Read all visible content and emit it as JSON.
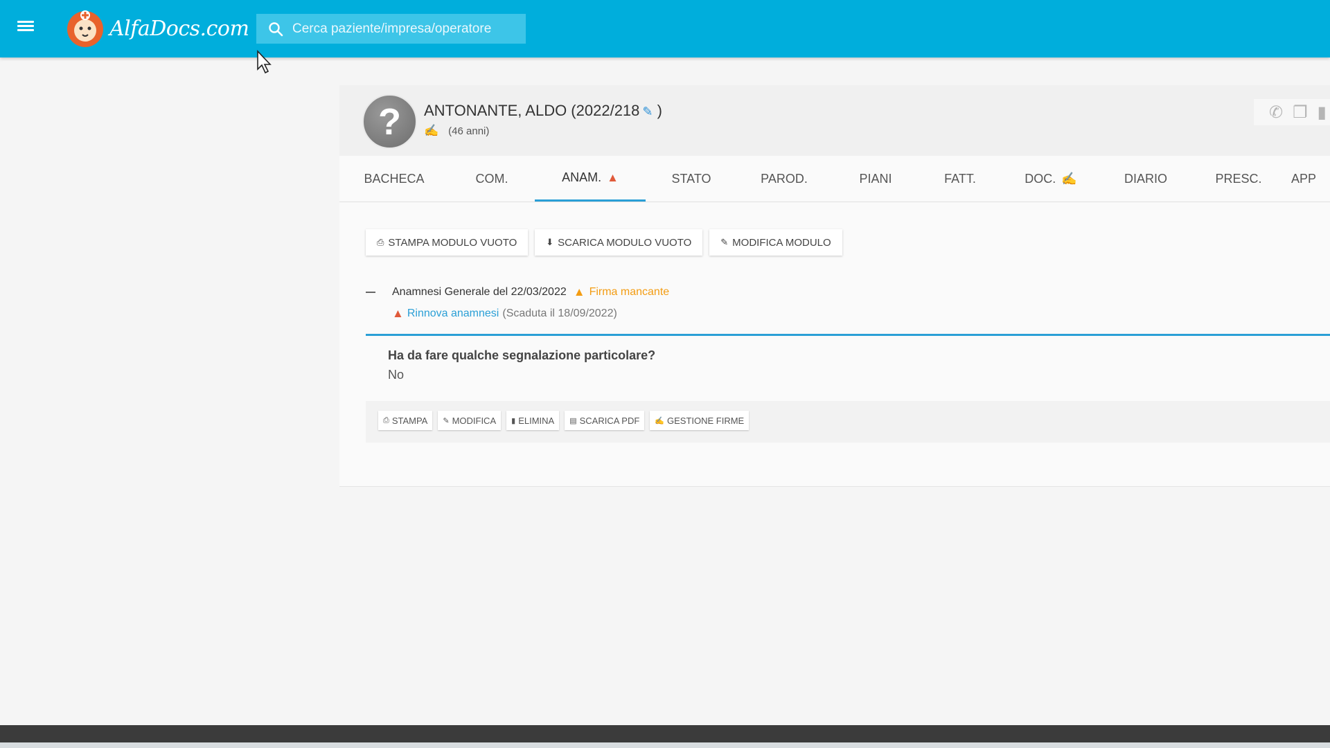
{
  "app": {
    "logo_text": "AlfaDocs.com",
    "search": {
      "placeholder": "Cerca paziente/impresa/operatore"
    }
  },
  "patient": {
    "avatar_glyph": "?",
    "name": "ANTONANTE, ALDO (2022/218",
    "name_close": ")",
    "age": "(46 anni)"
  },
  "icons": {
    "header_actions": [
      "whatsapp-icon",
      "copy-icon",
      "trash-icon"
    ]
  },
  "tabs": [
    {
      "label": "BACHECA",
      "active": false
    },
    {
      "label": "COM.",
      "active": false
    },
    {
      "label": "ANAM.",
      "active": true,
      "badge": "warning-icon"
    },
    {
      "label": "STATO",
      "active": false
    },
    {
      "label": "PAROD.",
      "active": false
    },
    {
      "label": "PIANI",
      "active": false
    },
    {
      "label": "FATT.",
      "active": false
    },
    {
      "label": "DOC.",
      "active": false,
      "badge": "signature-icon"
    },
    {
      "label": "DIARIO",
      "active": false
    },
    {
      "label": "PRESC.",
      "active": false
    },
    {
      "label": "APP",
      "active": false
    }
  ],
  "actions": {
    "print_empty": "STAMPA MODULO VUOTO",
    "download_empty": "SCARICA MODULO VUOTO",
    "edit_form": "MODIFICA MODULO"
  },
  "record": {
    "title": "Anamnesi Generale del 22/03/2022",
    "missing_signature": "Firma mancante",
    "renew_link": "Rinnova anamnesi",
    "expired": "(Scaduta il 18/09/2022)",
    "question": "Ha da fare qualche segnalazione particolare?",
    "answer": "No",
    "buttons": {
      "print": "STAMPA",
      "edit": "MODIFICA",
      "delete": "ELIMINA",
      "pdf": "SCARICA PDF",
      "signatures": "GESTIONE FIRME"
    }
  },
  "colors": {
    "topbar": "#00aedc",
    "accent_blue": "#2a9fd6",
    "warning_orange": "#f39c12",
    "alert_red": "#e05a3a"
  }
}
